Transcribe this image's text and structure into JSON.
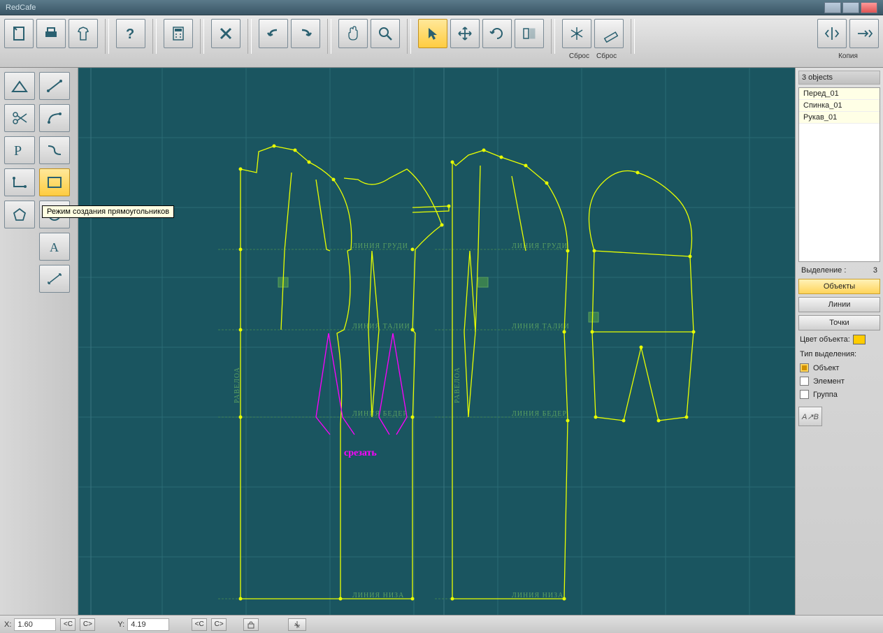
{
  "app": {
    "title": "RedCafe"
  },
  "toolbar": {
    "reset1": "Сброс",
    "reset2": "Сброс",
    "copy": "Копия"
  },
  "tooltip": "Режим создания прямоугольников",
  "right": {
    "count_label": "3 objects",
    "objects": [
      "Перед_01",
      "Спинка_01",
      "Рукав_01"
    ],
    "selection_label": "Выделение :",
    "selection_count": "3",
    "btn_objects": "Объекты",
    "btn_lines": "Линии",
    "btn_points": "Точки",
    "color_label": "Цвет объекта:",
    "color_value": "#ffcc00",
    "seltype_label": "Тип выделения:",
    "chk_object": "Объект",
    "chk_element": "Элемент",
    "chk_group": "Группа"
  },
  "canvas": {
    "line_chest": "ЛИНИЯ  ГРУДИ",
    "line_waist": "ЛИНИЯ  ТАЛИИ",
    "line_hip": "ЛИНИЯ  БЕДЕР",
    "line_hem": "ЛИНИЯ  НИЗА",
    "balance": "РАВЕЛОА",
    "annotation": "срезать"
  },
  "status": {
    "x_label": "X:",
    "x_value": "1.60",
    "y_label": "Y:",
    "y_value": "4.19",
    "lt": "<С",
    "gt": "С>"
  }
}
